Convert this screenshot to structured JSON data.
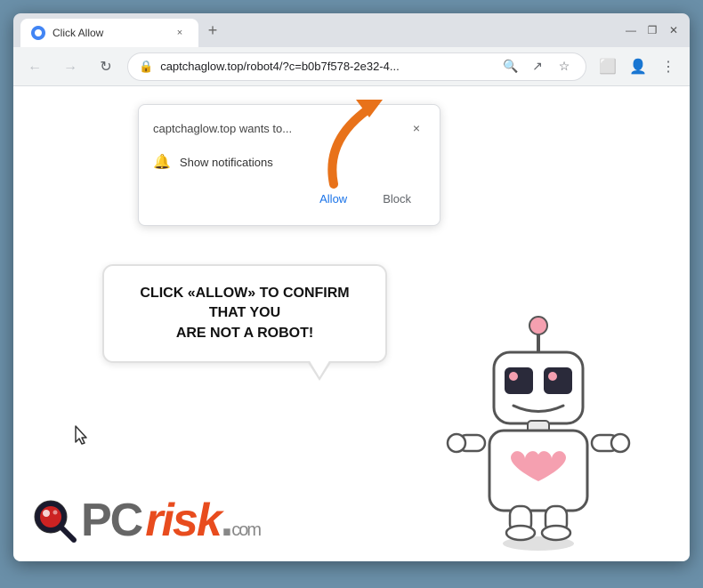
{
  "browser": {
    "tab_title": "Click Allow",
    "tab_close": "×",
    "new_tab": "+",
    "address": "captchaglow.top/robot4/?c=b0b7f578-2e32-4...",
    "window_minimize": "—",
    "window_restore": "❐",
    "window_close": "✕"
  },
  "nav": {
    "back": "←",
    "forward": "→",
    "refresh": "↻",
    "lock": "🔒"
  },
  "dialog": {
    "title": "captchaglow.top wants to...",
    "close": "×",
    "option": "Show notifications",
    "allow": "Allow",
    "block": "Block"
  },
  "bubble": {
    "line1": "CLICK «ALLOW» TO CONFIRM THAT YOU",
    "line2": "ARE NOT A ROBOT!"
  },
  "logo": {
    "pc": "PC",
    "risk": "risk",
    "dot": ".",
    "com": "com"
  }
}
